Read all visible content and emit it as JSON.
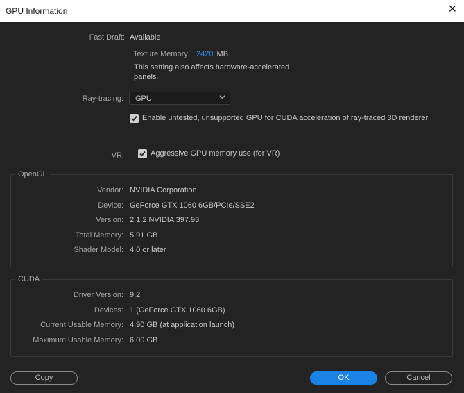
{
  "window": {
    "title": "GPU Information"
  },
  "fast_draft": {
    "label": "Fast Draft:",
    "value": "Available",
    "texture_memory_label": "Texture Memory:",
    "texture_memory_value": "2420",
    "texture_memory_unit": "MB",
    "note_line1": "This setting also affects hardware-accelerated",
    "note_line2": "panels."
  },
  "ray_tracing": {
    "label": "Ray-tracing:",
    "selected": "GPU",
    "cuda_checkbox_label": "Enable untested, unsupported GPU for CUDA acceleration of ray-traced 3D renderer"
  },
  "vr": {
    "label": "VR:",
    "checkbox_label": "Aggressive GPU memory use (for VR)"
  },
  "opengl": {
    "title": "OpenGL",
    "rows": [
      {
        "label": "Vendor:",
        "value": "NVIDIA Corporation"
      },
      {
        "label": "Device:",
        "value": "GeForce GTX 1060 6GB/PCIe/SSE2"
      },
      {
        "label": "Version:",
        "value": "2.1.2 NVIDIA 397.93"
      },
      {
        "label": "Total Memory:",
        "value": "5.91 GB"
      },
      {
        "label": "Shader Model:",
        "value": "4.0 or later"
      }
    ]
  },
  "cuda": {
    "title": "CUDA",
    "rows": [
      {
        "label": "Driver Version:",
        "value": "9.2"
      },
      {
        "label": "Devices:",
        "value": "1 (GeForce GTX 1060 6GB)"
      },
      {
        "label": "Current Usable Memory:",
        "value": "4.90 GB (at application launch)"
      },
      {
        "label": "Maximum Usable Memory:",
        "value": "6.00 GB"
      }
    ]
  },
  "buttons": {
    "copy": "Copy",
    "ok": "OK",
    "cancel": "Cancel"
  },
  "colors": {
    "accent": "#1c83e6",
    "highlight": "#2d8ceb",
    "background": "#232323"
  },
  "icons": {
    "close": "close-icon",
    "dropdown": "chevron-down-icon",
    "check": "checkmark-icon"
  }
}
